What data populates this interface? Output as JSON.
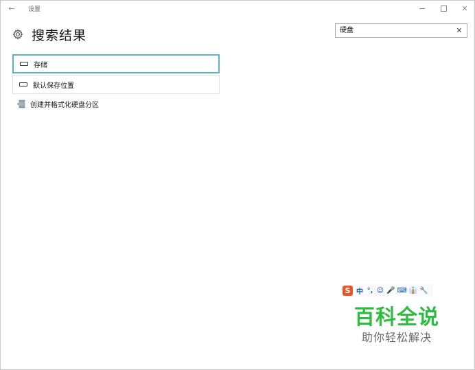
{
  "titlebar": {
    "app_title": "设置",
    "back_icon": "arrow-left-icon",
    "min_icon": "minimize-icon",
    "max_icon": "maximize-icon",
    "close_icon": "close-icon"
  },
  "header": {
    "title": "搜索结果",
    "icon": "gear-icon"
  },
  "search": {
    "value": "硬盘",
    "clear_icon": "clear-icon"
  },
  "results": [
    {
      "label": "存储",
      "icon": "drive-icon",
      "selected": true
    },
    {
      "label": "默认保存位置",
      "icon": "drive-icon",
      "selected": false
    },
    {
      "label": "创建并格式化硬盘分区",
      "icon": "disk-management-icon",
      "selected": false
    }
  ],
  "ime": {
    "logo": "S",
    "mode": "中",
    "items": [
      "°,",
      "☺",
      "🎤",
      "⌨",
      "👔",
      "🔧"
    ]
  },
  "watermark": {
    "main": "百科全说",
    "sub": "助你轻松解决"
  },
  "colors": {
    "accent": "#5ab4c4",
    "ime_brand": "#e8572a",
    "watermark_green": "#2dbd3f"
  }
}
